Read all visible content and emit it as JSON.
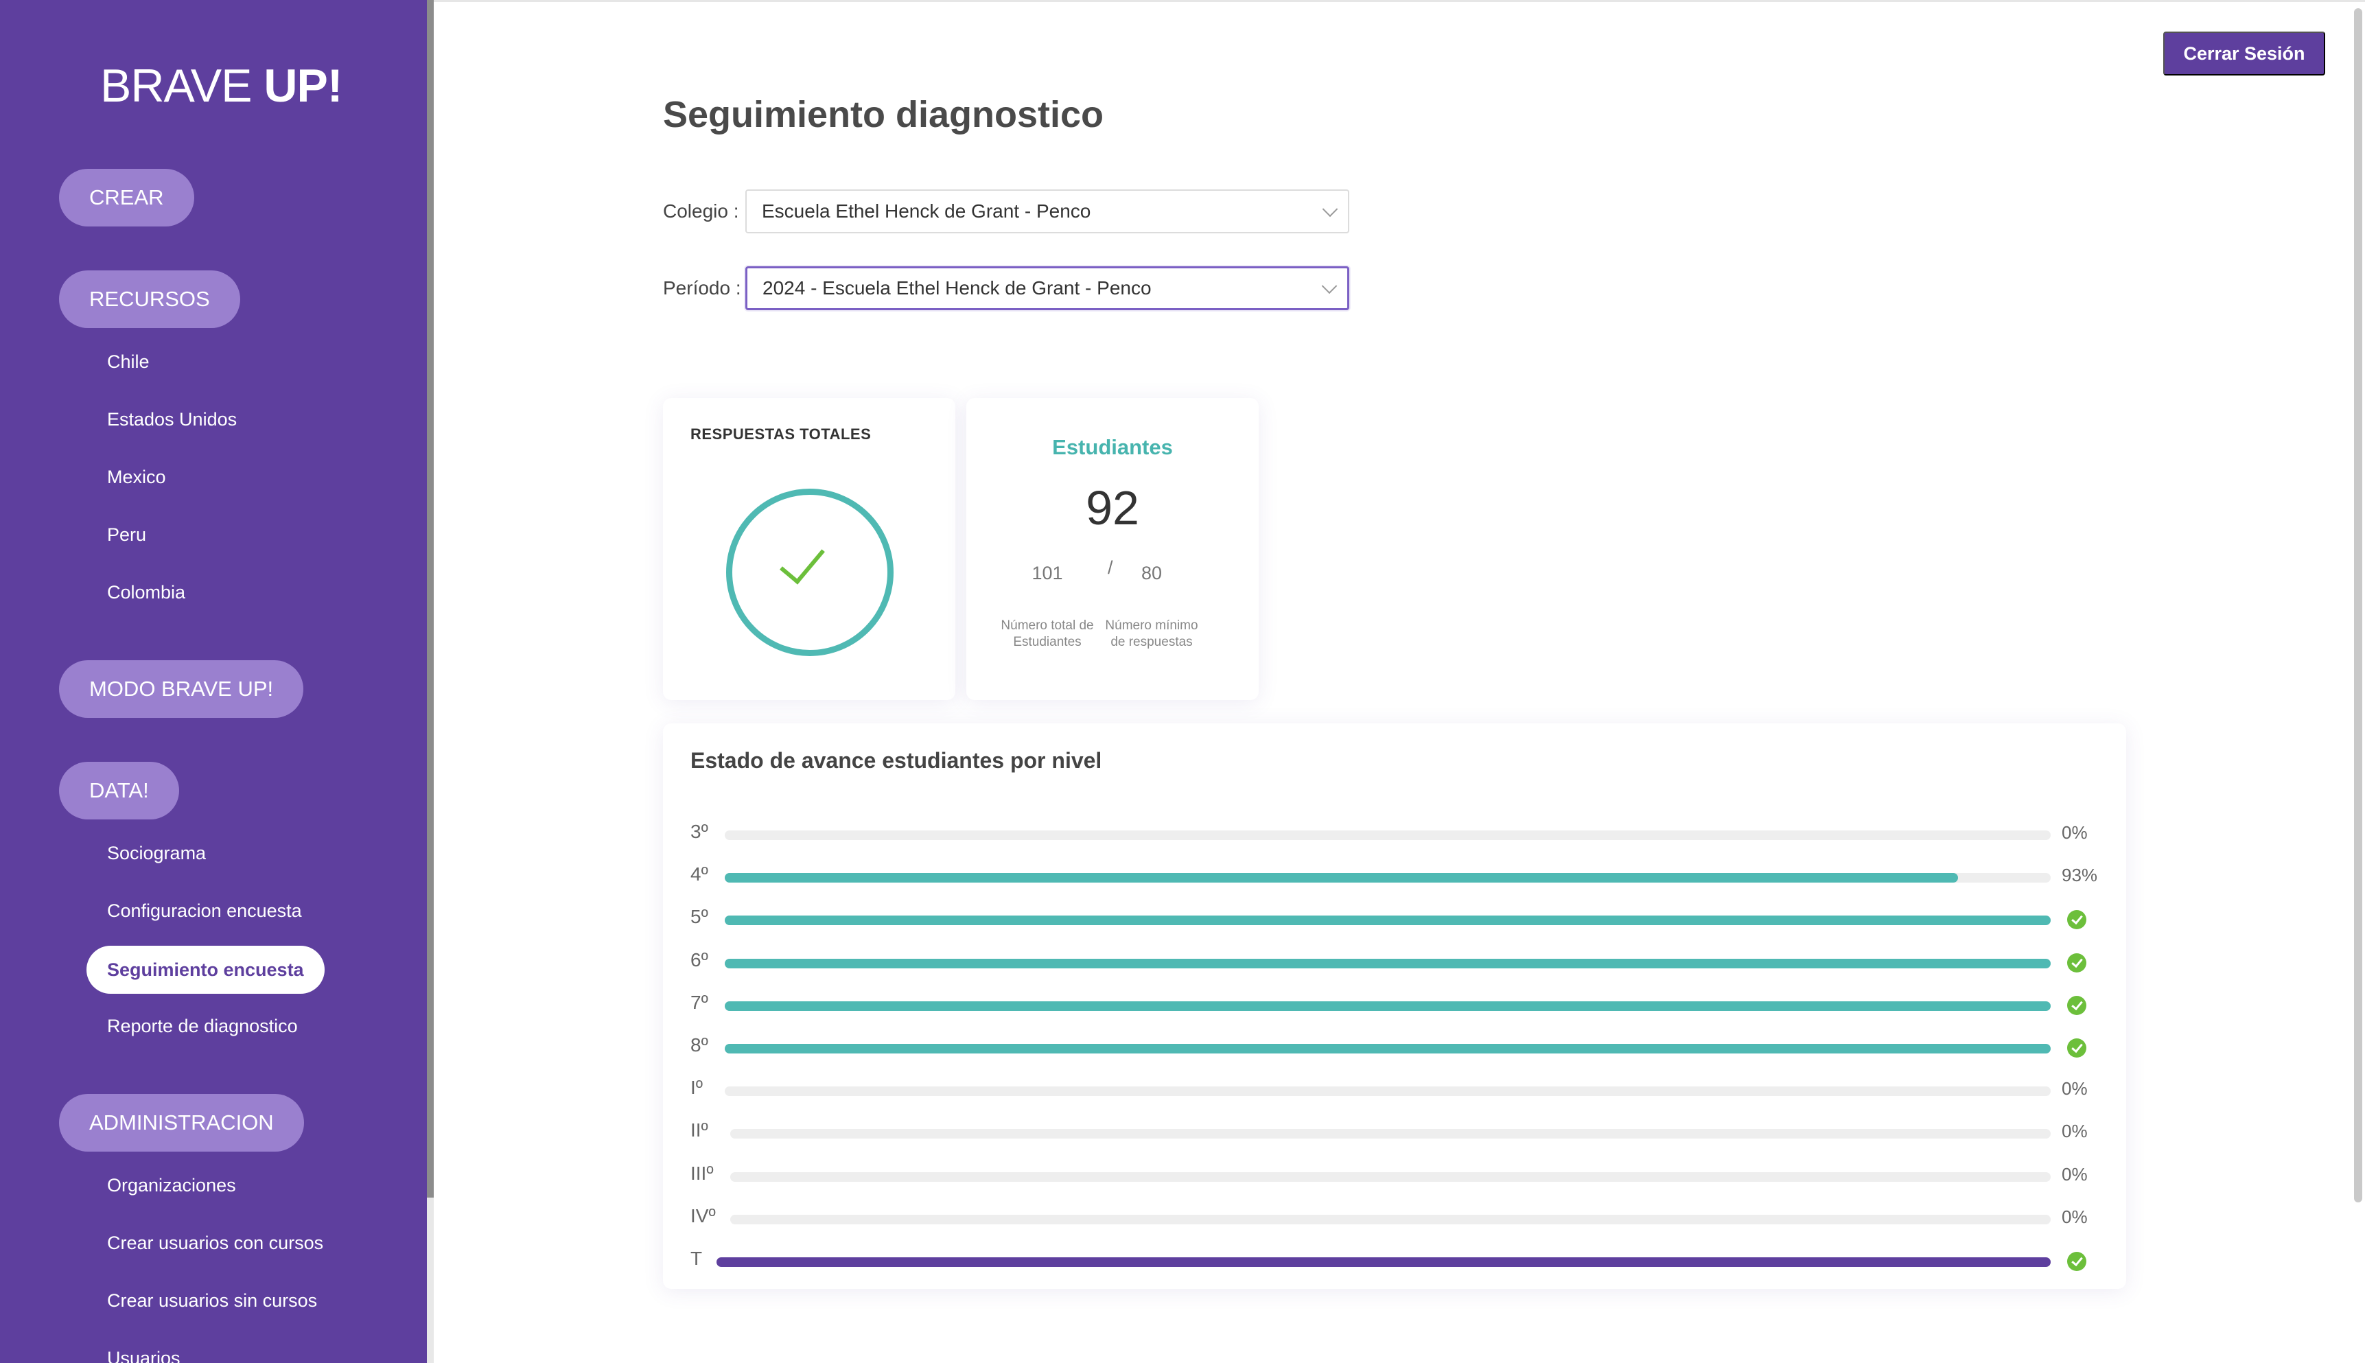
{
  "brand": {
    "logo_light": "BRAVE ",
    "logo_bold": "UP!"
  },
  "sidebar": {
    "sections": {
      "crear": "CREAR",
      "recursos": "RECURSOS",
      "modo": "MODO BRAVE UP!",
      "data": "DATA!",
      "admin": "ADMINISTRACION"
    },
    "recursos_items": [
      "Chile",
      "Estados Unidos",
      "Mexico",
      "Peru",
      "Colombia"
    ],
    "data_items": [
      "Sociograma",
      "Configuracion encuesta",
      "Seguimiento encuesta",
      "Reporte de diagnostico"
    ],
    "admin_items": [
      "Organizaciones",
      "Crear usuarios con cursos",
      "Crear usuarios sin cursos",
      "Usuarios"
    ],
    "active_item": "Seguimiento encuesta"
  },
  "header": {
    "logout_label": "Cerrar Sesión"
  },
  "page": {
    "title": "Seguimiento diagnostico"
  },
  "filters": {
    "colegio_label": "Colegio :",
    "colegio_value": "Escuela Ethel Henck de Grant - Penco",
    "periodo_label": "Período :",
    "periodo_value": "2024 - Escuela Ethel Henck de Grant - Penco"
  },
  "responses_card": {
    "title": "RESPUESTAS TOTALES"
  },
  "students_card": {
    "title": "Estudiantes",
    "count": "92",
    "total": "101",
    "separator": "/",
    "minimum": "80",
    "total_caption": "Número total de Estudiantes",
    "minimum_caption": "Número mínimo de respuestas"
  },
  "progress": {
    "title": "Estado de avance estudiantes por nivel",
    "rows": [
      {
        "label": "3º",
        "percent": 0,
        "value": "0%",
        "complete": false
      },
      {
        "label": "4º",
        "percent": 93,
        "value": "93%",
        "complete": false
      },
      {
        "label": "5º",
        "percent": 100,
        "value": "",
        "complete": true
      },
      {
        "label": "6º",
        "percent": 100,
        "value": "",
        "complete": true
      },
      {
        "label": "7º",
        "percent": 100,
        "value": "",
        "complete": true
      },
      {
        "label": "8º",
        "percent": 100,
        "value": "",
        "complete": true
      },
      {
        "label": "Iº",
        "percent": 0,
        "value": "0%",
        "complete": false
      },
      {
        "label": "IIº",
        "percent": 0,
        "value": "0%",
        "complete": false
      },
      {
        "label": "IIIº",
        "percent": 0,
        "value": "0%",
        "complete": false
      },
      {
        "label": "IVº",
        "percent": 0,
        "value": "0%",
        "complete": false
      },
      {
        "label": "T",
        "percent": 100,
        "value": "",
        "complete": true,
        "total": true
      }
    ]
  },
  "colors": {
    "brand_purple": "#5e3f9e",
    "teal": "#4fb9b3",
    "success_green": "#6cbf3b"
  }
}
